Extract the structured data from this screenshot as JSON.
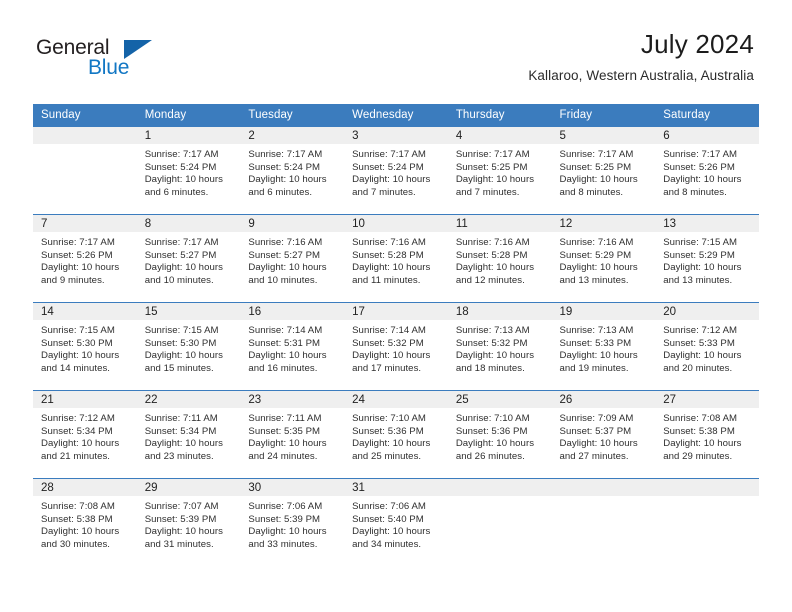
{
  "brand": {
    "name_part1": "General",
    "name_part2": "Blue",
    "triangle_icon": "triangle-icon",
    "accent_blue": "#1277c4",
    "logo_triangle_blue": "#1463a8"
  },
  "header": {
    "month_title": "July 2024",
    "location": "Kallaroo, Western Australia, Australia"
  },
  "calendar": {
    "header_background": "#3b7cbe",
    "daynum_band_background": "#efefef",
    "weekday_headers": [
      "Sunday",
      "Monday",
      "Tuesday",
      "Wednesday",
      "Thursday",
      "Friday",
      "Saturday"
    ],
    "weeks": [
      [
        {
          "day": "",
          "sunrise": "",
          "sunset": "",
          "daylight_line1": "",
          "daylight_line2": "",
          "empty": true
        },
        {
          "day": "1",
          "sunrise": "Sunrise: 7:17 AM",
          "sunset": "Sunset: 5:24 PM",
          "daylight_line1": "Daylight: 10 hours",
          "daylight_line2": "and 6 minutes.",
          "empty": false
        },
        {
          "day": "2",
          "sunrise": "Sunrise: 7:17 AM",
          "sunset": "Sunset: 5:24 PM",
          "daylight_line1": "Daylight: 10 hours",
          "daylight_line2": "and 6 minutes.",
          "empty": false
        },
        {
          "day": "3",
          "sunrise": "Sunrise: 7:17 AM",
          "sunset": "Sunset: 5:24 PM",
          "daylight_line1": "Daylight: 10 hours",
          "daylight_line2": "and 7 minutes.",
          "empty": false
        },
        {
          "day": "4",
          "sunrise": "Sunrise: 7:17 AM",
          "sunset": "Sunset: 5:25 PM",
          "daylight_line1": "Daylight: 10 hours",
          "daylight_line2": "and 7 minutes.",
          "empty": false
        },
        {
          "day": "5",
          "sunrise": "Sunrise: 7:17 AM",
          "sunset": "Sunset: 5:25 PM",
          "daylight_line1": "Daylight: 10 hours",
          "daylight_line2": "and 8 minutes.",
          "empty": false
        },
        {
          "day": "6",
          "sunrise": "Sunrise: 7:17 AM",
          "sunset": "Sunset: 5:26 PM",
          "daylight_line1": "Daylight: 10 hours",
          "daylight_line2": "and 8 minutes.",
          "empty": false
        }
      ],
      [
        {
          "day": "7",
          "sunrise": "Sunrise: 7:17 AM",
          "sunset": "Sunset: 5:26 PM",
          "daylight_line1": "Daylight: 10 hours",
          "daylight_line2": "and 9 minutes.",
          "empty": false
        },
        {
          "day": "8",
          "sunrise": "Sunrise: 7:17 AM",
          "sunset": "Sunset: 5:27 PM",
          "daylight_line1": "Daylight: 10 hours",
          "daylight_line2": "and 10 minutes.",
          "empty": false
        },
        {
          "day": "9",
          "sunrise": "Sunrise: 7:16 AM",
          "sunset": "Sunset: 5:27 PM",
          "daylight_line1": "Daylight: 10 hours",
          "daylight_line2": "and 10 minutes.",
          "empty": false
        },
        {
          "day": "10",
          "sunrise": "Sunrise: 7:16 AM",
          "sunset": "Sunset: 5:28 PM",
          "daylight_line1": "Daylight: 10 hours",
          "daylight_line2": "and 11 minutes.",
          "empty": false
        },
        {
          "day": "11",
          "sunrise": "Sunrise: 7:16 AM",
          "sunset": "Sunset: 5:28 PM",
          "daylight_line1": "Daylight: 10 hours",
          "daylight_line2": "and 12 minutes.",
          "empty": false
        },
        {
          "day": "12",
          "sunrise": "Sunrise: 7:16 AM",
          "sunset": "Sunset: 5:29 PM",
          "daylight_line1": "Daylight: 10 hours",
          "daylight_line2": "and 13 minutes.",
          "empty": false
        },
        {
          "day": "13",
          "sunrise": "Sunrise: 7:15 AM",
          "sunset": "Sunset: 5:29 PM",
          "daylight_line1": "Daylight: 10 hours",
          "daylight_line2": "and 13 minutes.",
          "empty": false
        }
      ],
      [
        {
          "day": "14",
          "sunrise": "Sunrise: 7:15 AM",
          "sunset": "Sunset: 5:30 PM",
          "daylight_line1": "Daylight: 10 hours",
          "daylight_line2": "and 14 minutes.",
          "empty": false
        },
        {
          "day": "15",
          "sunrise": "Sunrise: 7:15 AM",
          "sunset": "Sunset: 5:30 PM",
          "daylight_line1": "Daylight: 10 hours",
          "daylight_line2": "and 15 minutes.",
          "empty": false
        },
        {
          "day": "16",
          "sunrise": "Sunrise: 7:14 AM",
          "sunset": "Sunset: 5:31 PM",
          "daylight_line1": "Daylight: 10 hours",
          "daylight_line2": "and 16 minutes.",
          "empty": false
        },
        {
          "day": "17",
          "sunrise": "Sunrise: 7:14 AM",
          "sunset": "Sunset: 5:32 PM",
          "daylight_line1": "Daylight: 10 hours",
          "daylight_line2": "and 17 minutes.",
          "empty": false
        },
        {
          "day": "18",
          "sunrise": "Sunrise: 7:13 AM",
          "sunset": "Sunset: 5:32 PM",
          "daylight_line1": "Daylight: 10 hours",
          "daylight_line2": "and 18 minutes.",
          "empty": false
        },
        {
          "day": "19",
          "sunrise": "Sunrise: 7:13 AM",
          "sunset": "Sunset: 5:33 PM",
          "daylight_line1": "Daylight: 10 hours",
          "daylight_line2": "and 19 minutes.",
          "empty": false
        },
        {
          "day": "20",
          "sunrise": "Sunrise: 7:12 AM",
          "sunset": "Sunset: 5:33 PM",
          "daylight_line1": "Daylight: 10 hours",
          "daylight_line2": "and 20 minutes.",
          "empty": false
        }
      ],
      [
        {
          "day": "21",
          "sunrise": "Sunrise: 7:12 AM",
          "sunset": "Sunset: 5:34 PM",
          "daylight_line1": "Daylight: 10 hours",
          "daylight_line2": "and 21 minutes.",
          "empty": false
        },
        {
          "day": "22",
          "sunrise": "Sunrise: 7:11 AM",
          "sunset": "Sunset: 5:34 PM",
          "daylight_line1": "Daylight: 10 hours",
          "daylight_line2": "and 23 minutes.",
          "empty": false
        },
        {
          "day": "23",
          "sunrise": "Sunrise: 7:11 AM",
          "sunset": "Sunset: 5:35 PM",
          "daylight_line1": "Daylight: 10 hours",
          "daylight_line2": "and 24 minutes.",
          "empty": false
        },
        {
          "day": "24",
          "sunrise": "Sunrise: 7:10 AM",
          "sunset": "Sunset: 5:36 PM",
          "daylight_line1": "Daylight: 10 hours",
          "daylight_line2": "and 25 minutes.",
          "empty": false
        },
        {
          "day": "25",
          "sunrise": "Sunrise: 7:10 AM",
          "sunset": "Sunset: 5:36 PM",
          "daylight_line1": "Daylight: 10 hours",
          "daylight_line2": "and 26 minutes.",
          "empty": false
        },
        {
          "day": "26",
          "sunrise": "Sunrise: 7:09 AM",
          "sunset": "Sunset: 5:37 PM",
          "daylight_line1": "Daylight: 10 hours",
          "daylight_line2": "and 27 minutes.",
          "empty": false
        },
        {
          "day": "27",
          "sunrise": "Sunrise: 7:08 AM",
          "sunset": "Sunset: 5:38 PM",
          "daylight_line1": "Daylight: 10 hours",
          "daylight_line2": "and 29 minutes.",
          "empty": false
        }
      ],
      [
        {
          "day": "28",
          "sunrise": "Sunrise: 7:08 AM",
          "sunset": "Sunset: 5:38 PM",
          "daylight_line1": "Daylight: 10 hours",
          "daylight_line2": "and 30 minutes.",
          "empty": false
        },
        {
          "day": "29",
          "sunrise": "Sunrise: 7:07 AM",
          "sunset": "Sunset: 5:39 PM",
          "daylight_line1": "Daylight: 10 hours",
          "daylight_line2": "and 31 minutes.",
          "empty": false
        },
        {
          "day": "30",
          "sunrise": "Sunrise: 7:06 AM",
          "sunset": "Sunset: 5:39 PM",
          "daylight_line1": "Daylight: 10 hours",
          "daylight_line2": "and 33 minutes.",
          "empty": false
        },
        {
          "day": "31",
          "sunrise": "Sunrise: 7:06 AM",
          "sunset": "Sunset: 5:40 PM",
          "daylight_line1": "Daylight: 10 hours",
          "daylight_line2": "and 34 minutes.",
          "empty": false
        },
        {
          "day": "",
          "sunrise": "",
          "sunset": "",
          "daylight_line1": "",
          "daylight_line2": "",
          "empty": true
        },
        {
          "day": "",
          "sunrise": "",
          "sunset": "",
          "daylight_line1": "",
          "daylight_line2": "",
          "empty": true
        },
        {
          "day": "",
          "sunrise": "",
          "sunset": "",
          "daylight_line1": "",
          "daylight_line2": "",
          "empty": true
        }
      ]
    ]
  }
}
